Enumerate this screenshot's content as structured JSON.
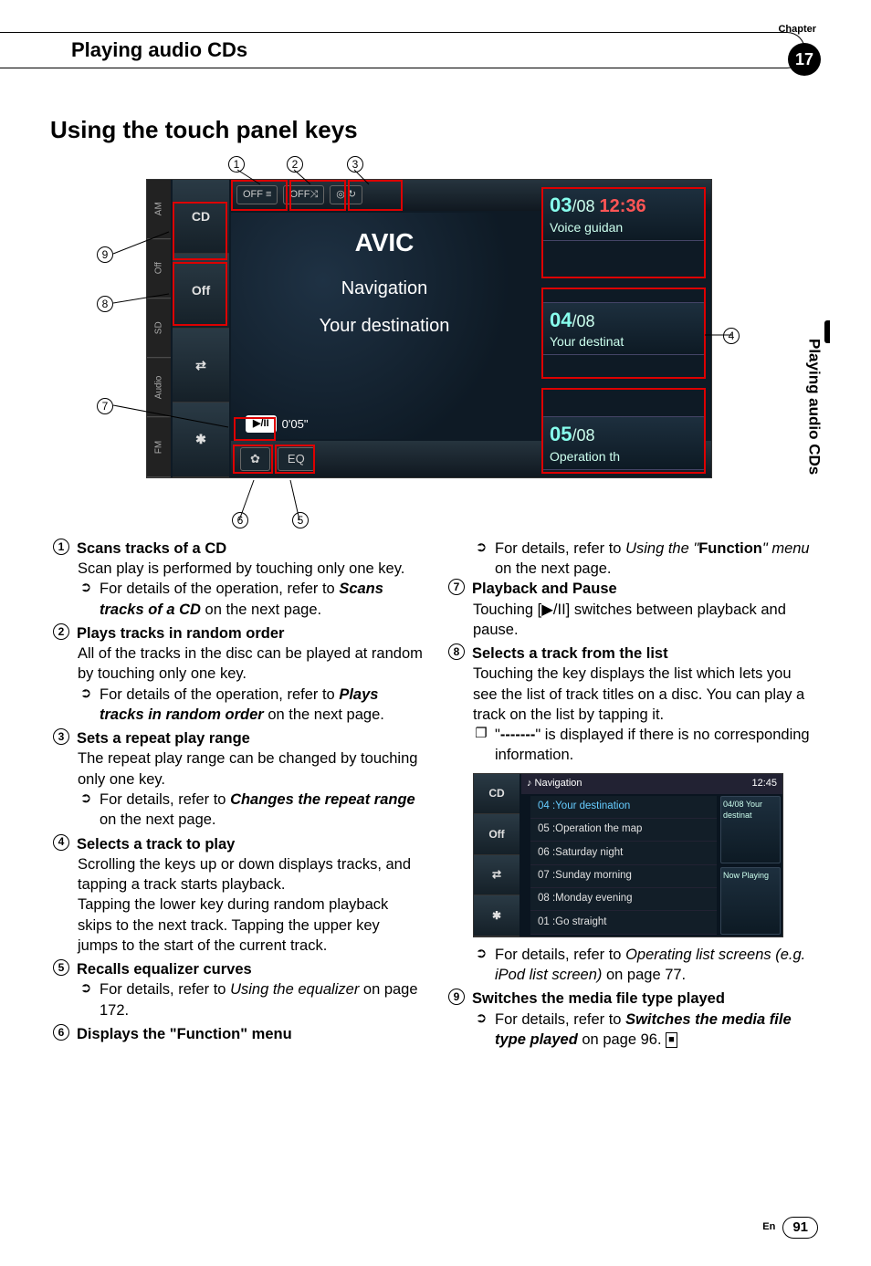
{
  "chapter_label": "Chapter",
  "chapter_number": "17",
  "title_band": "Playing audio CDs",
  "section_heading": "Using the touch panel keys",
  "side_margin_text": "Playing audio CDs",
  "figure": {
    "side_tabs": [
      "AM",
      "Off",
      "SD",
      "Audio",
      "FM"
    ],
    "left_icons": [
      "CD",
      "Off",
      "⇄",
      "✱"
    ],
    "top_buttons": {
      "b1": "OFF ≡",
      "b2": "OFF⤨",
      "b3": "◎ ↻"
    },
    "mid": {
      "title": "AVIC",
      "line1": "Navigation",
      "line2": "Your destination"
    },
    "play_btn": "▶/II",
    "time": "0'05\"",
    "bottom": {
      "settings": "✿",
      "eq": "EQ"
    },
    "right_cards": {
      "c1": {
        "cur": "03",
        "tot": "/08",
        "time": "12:36",
        "lab": "Voice guidan"
      },
      "c2": {
        "cur": "04",
        "tot": "/08",
        "lab": "Your destinat"
      },
      "c3": {
        "cur": "05",
        "tot": "/08",
        "lab": "Operation th"
      }
    },
    "callouts": {
      "1": "1",
      "2": "2",
      "3": "3",
      "4": "4",
      "5": "5",
      "6": "6",
      "7": "7",
      "8": "8",
      "9": "9"
    }
  },
  "items": {
    "1": {
      "title": "Scans tracks of a CD",
      "body": "Scan play is performed by touching only one key.",
      "sub": "For details of the operation, refer to ",
      "sub_bi": "Scans tracks of a CD",
      "sub_tail": " on the next page."
    },
    "2": {
      "title": "Plays tracks in random order",
      "body": "All of the tracks in the disc can be played at random by touching only one key.",
      "sub": "For details of the operation, refer to ",
      "sub_bi": "Plays tracks in random order",
      "sub_tail": " on the next page."
    },
    "3": {
      "title": "Sets a repeat play range",
      "body": "The repeat play range can be changed by touching only one key.",
      "sub": "For details, refer to ",
      "sub_bi": "Changes the repeat range",
      "sub_tail": " on the next page."
    },
    "4": {
      "title": "Selects a track to play",
      "body": "Scrolling the keys up or down displays tracks, and tapping a track starts playback.",
      "body2": "Tapping the lower key during random playback skips to the next track. Tapping the upper key jumps to the start of the current track."
    },
    "5": {
      "title": "Recalls equalizer curves",
      "sub": "For details, refer to ",
      "sub_i": "Using the equalizer",
      "sub_tail": " on page 172."
    },
    "6": {
      "title": "Displays the \"Function\" menu",
      "sub": "For details, refer to ",
      "sub_i1": "Using the ",
      "sub_q": "\"",
      "sub_b": "Function",
      "sub_q2": "\"",
      "sub_i2": " menu",
      "sub_tail": " on the next page."
    },
    "7": {
      "title": "Playback and Pause",
      "body_pre": "Touching [",
      "body_sym": "▶/II",
      "body_post": "] switches between playback and pause."
    },
    "8": {
      "title": "Selects a track from the list",
      "body": "Touching the key displays the list which lets you see the list of track titles on a disc. You can play a track on the list by tapping it.",
      "note_pre": "\"",
      "note_b": "-------",
      "note_post": "\" is displayed if there is no corresponding information.",
      "sub": "For details, refer to ",
      "sub_i": "Operating list screens (e.g. iPod list screen)",
      "sub_tail": " on page 77."
    },
    "9": {
      "title": "Switches the media file type played",
      "sub": "For details, refer to ",
      "sub_bi": "Switches the media file type played",
      "sub_tail": " on page 96."
    }
  },
  "small_fig": {
    "side": [
      "CD",
      "Off",
      "⇄",
      "✱"
    ],
    "top_left": "♪  Navigation",
    "top_right": "12:45",
    "rows": [
      "04 :Your destination",
      "05 :Operation the map",
      "06 :Saturday night",
      "07 :Sunday morning",
      "08 :Monday evening",
      "01 :Go straight"
    ],
    "right1": "04/08 Your destinat",
    "right2": "Now Playing"
  },
  "end_symbol": "■",
  "footer": {
    "en": "En",
    "page": "91"
  }
}
